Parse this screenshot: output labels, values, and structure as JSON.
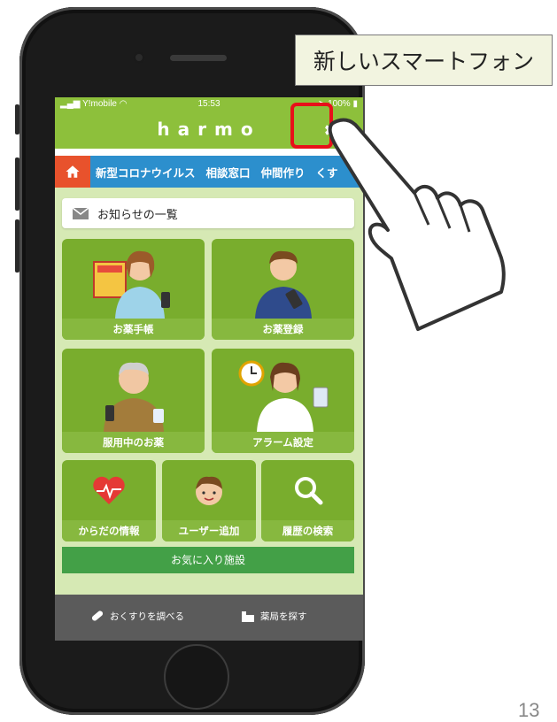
{
  "statusbar": {
    "carrier": "Y!mobile",
    "time": "15:53",
    "battery": "100%"
  },
  "header": {
    "app_name": "harmo"
  },
  "tabs": [
    "新型コロナウイルス",
    "相談窓口",
    "仲間作り",
    "くす"
  ],
  "notice": {
    "label": "お知らせの一覧"
  },
  "tiles": {
    "medicine_notebook": "お薬手帳",
    "medicine_register": "お薬登録",
    "current_medicine": "服用中のお薬",
    "alarm_settings": "アラーム設定",
    "body_info": "からだの情報",
    "add_user": "ユーザー追加",
    "history_search": "履歴の検索"
  },
  "favorite_facilities": "お気に入り施設",
  "bottom_nav": {
    "search_medicine": "おくすりを調べる",
    "find_pharmacy": "薬局を探す"
  },
  "callout": "新しいスマートフォン",
  "page_number": "13",
  "colors": {
    "header_green": "#8dc03b",
    "tab_blue": "#2c8fcd",
    "home_orange": "#e8522c",
    "tile_green": "#79ad2d",
    "fav_green": "#43a047",
    "highlight_red": "#e8101a"
  },
  "icons": [
    "gear-icon",
    "home-icon",
    "mail-icon",
    "heart-icon",
    "magnifier-icon",
    "capsule-icon",
    "pharmacy-icon",
    "pointing-hand-icon"
  ]
}
